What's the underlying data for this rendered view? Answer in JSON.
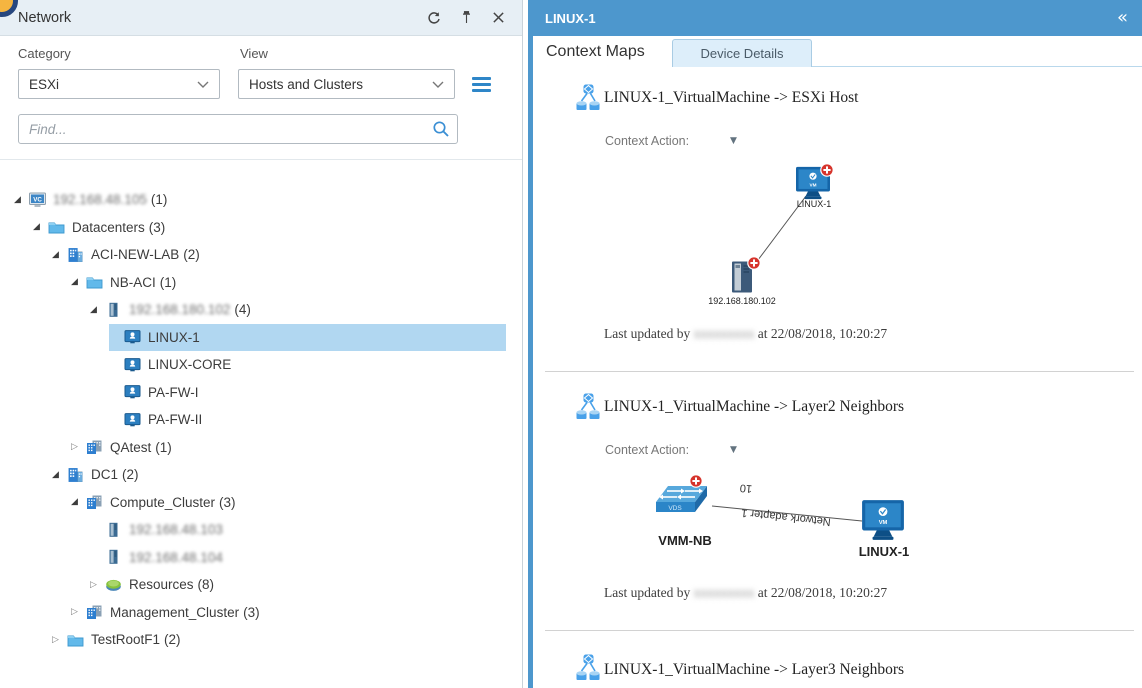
{
  "left_panel": {
    "title": "Network",
    "category": {
      "label": "Category",
      "value": "ESXi"
    },
    "view": {
      "label": "View",
      "value": "Hosts and Clusters"
    },
    "find_placeholder": "Find...",
    "tree": [
      {
        "label": "192.168.48.105",
        "count": "(1)"
      },
      {
        "label": "Datacenters",
        "count": "(3)"
      },
      {
        "label": "ACI-NEW-LAB",
        "count": "(2)"
      },
      {
        "label": "NB-ACI",
        "count": "(1)"
      },
      {
        "label": "192.168.180.102",
        "count": "(4)"
      },
      {
        "label": "LINUX-1",
        "selected": true
      },
      {
        "label": "LINUX-CORE"
      },
      {
        "label": "PA-FW-I"
      },
      {
        "label": "PA-FW-II"
      },
      {
        "label": "QAtest",
        "count": "(1)"
      },
      {
        "label": "DC1",
        "count": "(2)"
      },
      {
        "label": "Compute_Cluster",
        "count": "(3)"
      },
      {
        "label": "192.168.48.103"
      },
      {
        "label": "192.168.48.104"
      },
      {
        "label": "Resources",
        "count": "(8)"
      },
      {
        "label": "Management_Cluster",
        "count": "(3)"
      },
      {
        "label": "TestRootF1",
        "count": "(2)"
      }
    ]
  },
  "right_panel": {
    "title": "LINUX-1",
    "collapse_glyph": "«",
    "tabs": {
      "context_maps": "Context Maps",
      "device_details": "Device Details"
    },
    "sections": [
      {
        "title": "LINUX-1_VirtualMachine -> ESXi Host",
        "context_action_label": "Context Action:",
        "map": {
          "nodes": [
            {
              "label": "LINUX-1"
            },
            {
              "label": "192.168.180.102"
            }
          ]
        },
        "last_updated": {
          "prefix": "Last updated by",
          "user_redacted": "xxxxxxxxx",
          "rest": "at 22/08/2018, 10:20:27"
        }
      },
      {
        "title": "LINUX-1_VirtualMachine -> Layer2 Neighbors",
        "context_action_label": "Context Action:",
        "map": {
          "nodes": [
            {
              "label": "VMM-NB"
            },
            {
              "label": "LINUX-1"
            }
          ],
          "link_labels": [
            "10",
            "Network adapter 1"
          ]
        },
        "last_updated": {
          "prefix": "Last updated by",
          "user_redacted": "xxxxxxxxx",
          "rest": "at 22/08/2018, 10:20:27"
        }
      },
      {
        "title": "LINUX-1_VirtualMachine -> Layer3 Neighbors"
      }
    ],
    "accent_blue": "#4d97cd"
  }
}
